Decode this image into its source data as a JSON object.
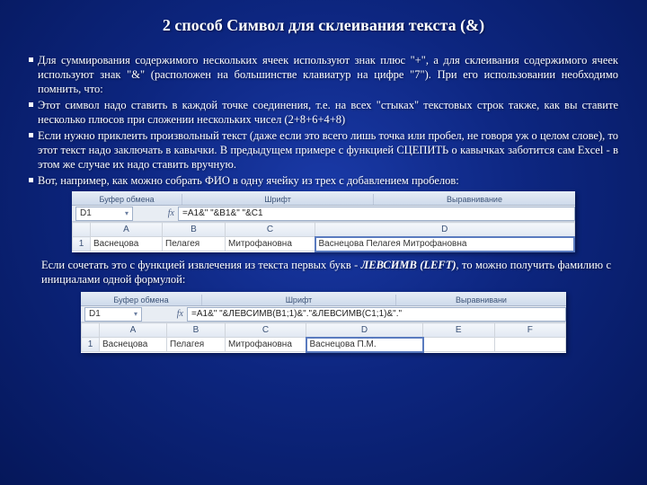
{
  "title": "2 способ Символ для склеивания текста (&)",
  "bullets": [
    "Для суммирования содержимого нескольких ячеек используют знак плюс \"+\", а для склеивания содержимого ячеек используют знак \"&\" (расположен на большинстве клавиатур на цифре \"7\"). При его использовании необходимо помнить, что:",
    "Этот символ надо ставить в каждой точке соединения, т.е. на всех \"стыках\" текстовых строк также, как вы ставите несколько плюсов при сложении нескольких чисел (2+8+6+4+8)",
    "Если нужно приклеить произвольный текст (даже если это всего лишь точка или пробел, не говоря уж о целом слове), то этот текст надо заключать в кавычки. В предыдущем примере с функцией СЦЕПИТЬ о кавычках заботится сам Excel - в этом же случае их надо ставить вручную.",
    "Вот, например, как можно собрать ФИО в одну ячейку из трех с добавлением пробелов:"
  ],
  "xl1": {
    "ribbon": {
      "g1": "Буфер обмена",
      "g2": "Шрифт",
      "g3": "Выравнивание"
    },
    "namebox": "D1",
    "formula": "=A1&\" \"&B1&\" \"&C1",
    "cols": [
      "A",
      "B",
      "C",
      "D"
    ],
    "row": "1",
    "cells": [
      "Васнецова",
      "Пелагея",
      "Митрофановна",
      "Васнецова Пелагея Митрофановна"
    ]
  },
  "note_pre": "Если сочетать это с функцией извлечения из текста первых букв - ",
  "note_em": "ЛЕВСИМВ (LEFT)",
  "note_post": ", то можно получить фамилию с инициалами одной формулой:",
  "xl2": {
    "ribbon": {
      "g1": "Буфер обмена",
      "g2": "Шрифт",
      "g3": "Выравнивани"
    },
    "namebox": "D1",
    "formula": "=A1&\" \"&ЛЕВСИМВ(B1;1)&\".\"&ЛЕВСИМВ(C1;1)&\".\"",
    "cols": [
      "A",
      "B",
      "C",
      "D",
      "E",
      "F"
    ],
    "row": "1",
    "cells": [
      "Васнецова",
      "Пелагея",
      "Митрофановна",
      "Васнецова П.М.",
      "",
      ""
    ]
  }
}
